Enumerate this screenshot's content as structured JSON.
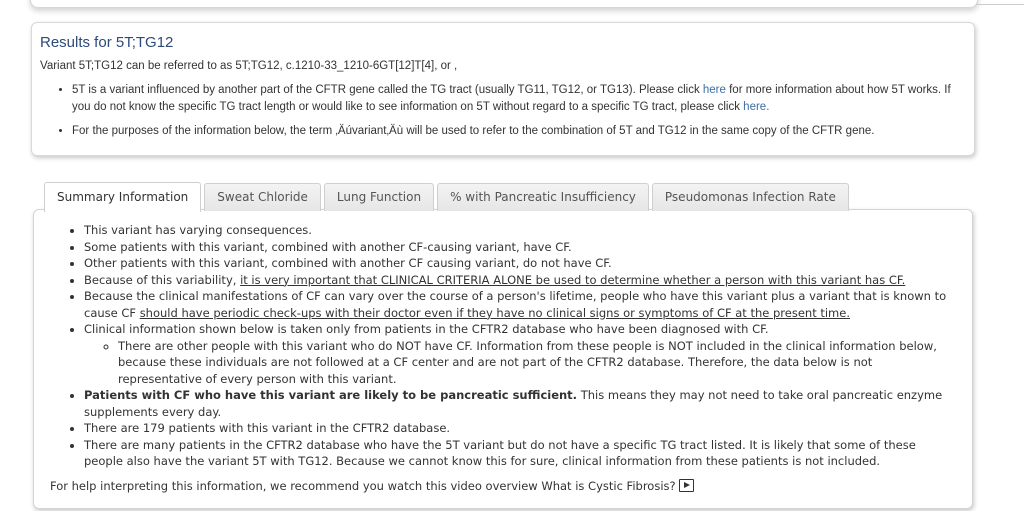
{
  "results": {
    "title": "Results for 5T;TG12",
    "intro": "Variant 5T;TG12 can be referred to as 5T;TG12, c.1210-33_1210-6GT[12]T[4], or ,",
    "bullet1": {
      "part1": "5T is a variant influenced by another part of the CFTR gene called the TG tract (usually TG11, TG12, or TG13). Please click ",
      "link1": "here",
      "part2": " for more information about how 5T works. If you do not know the specific TG tract length or would like to see information on 5T without regard to a specific TG tract, please click ",
      "link2": "here.",
      "part3": ""
    },
    "bullet2": "For the purposes of the information below, the term ‚Äúvariant‚Äù will be used to refer to the combination of 5T and TG12 in the same copy of the CFTR gene."
  },
  "tabs": [
    {
      "label": "Summary Information",
      "active": true
    },
    {
      "label": "Sweat Chloride",
      "active": false
    },
    {
      "label": "Lung Function",
      "active": false
    },
    {
      "label": "% with Pancreatic Insufficiency",
      "active": false
    },
    {
      "label": "Pseudomonas Infection Rate",
      "active": false
    }
  ],
  "summary": {
    "items": {
      "i1": "This variant has varying consequences.",
      "i2": "Some patients with this variant, combined with another CF-causing variant, have CF.",
      "i3": "Other patients with this variant, combined with another CF causing variant, do not have CF.",
      "i4_pre": "Because of this variability, ",
      "i4_u": "it is very important that CLINICAL CRITERIA ALONE be used to determine whether a person with this variant has CF.",
      "i5_pre": "Because the clinical manifestations of CF can vary over the course of a person's lifetime, people who have this variant plus a variant that is known to cause CF ",
      "i5_u": "should have periodic check-ups with their doctor even if they have no clinical signs or symptoms of CF at the present time.",
      "i6": "Clinical information shown below is taken only from patients in the CFTR2 database who have been diagnosed with CF.",
      "i6_sub": "There are other people with this variant who do NOT have CF. Information from these people is NOT included in the clinical information below, because these individuals are not followed at a CF center and are not part of the CFTR2 database. Therefore, the data below is not representative of every person with this variant.",
      "i7_b": "Patients with CF who have this variant are likely to be pancreatic sufficient.",
      "i7_rest": " This means they may not need to take oral pancreatic enzyme supplements every day.",
      "i8": "There are 179 patients with this variant in the CFTR2 database.",
      "i9": "There are many patients in the CFTR2 database who have the 5T variant but do not have a specific TG tract listed. It is likely that some of these people also have the variant 5T with TG12. Because we cannot know this for sure, clinical information from these patients is not included."
    },
    "help_text": "For help interpreting this information, we recommend you watch this video overview What is Cystic Fibrosis?",
    "video_icon": "play-video-icon"
  }
}
